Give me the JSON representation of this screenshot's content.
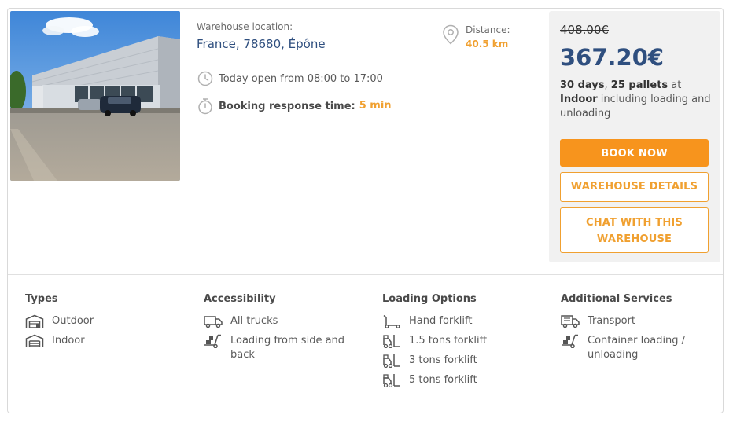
{
  "location": {
    "label": "Warehouse location:",
    "value": "France, 78680, Épône"
  },
  "hours": {
    "icon": "clock-icon",
    "text": "Today open from 08:00 to 17:00"
  },
  "response": {
    "icon": "stopwatch-icon",
    "label": "Booking response time:",
    "value": "5 min"
  },
  "distance": {
    "icon": "location-pin-icon",
    "label": "Distance:",
    "value": "40.5 km"
  },
  "pricing": {
    "old_price": "408.00€",
    "new_price": "367.20€",
    "summary_days": "30 days",
    "summary_sep": ", ",
    "summary_pallets": "25 pallets",
    "summary_at": " at ",
    "summary_storage": "Indoor",
    "summary_rest": " including loading and unloading"
  },
  "buttons": {
    "book": "BOOK NOW",
    "details": "WAREHOUSE DETAILS",
    "chat_line1": "CHAT WITH THIS",
    "chat_line2": "WAREHOUSE"
  },
  "features": {
    "types": {
      "title": "Types",
      "items": [
        {
          "label": "Outdoor",
          "icon": "outdoor-warehouse-icon"
        },
        {
          "label": "Indoor",
          "icon": "indoor-warehouse-icon"
        }
      ]
    },
    "accessibility": {
      "title": "Accessibility",
      "items": [
        {
          "label": "All trucks",
          "icon": "truck-icon"
        },
        {
          "label": "Loading from side and back",
          "icon": "hand-truck-boxes-icon"
        }
      ]
    },
    "loading": {
      "title": "Loading Options",
      "items": [
        {
          "label": "Hand forklift",
          "icon": "hand-pallet-jack-icon"
        },
        {
          "label": "1.5 tons forklift",
          "icon": "forklift-icon"
        },
        {
          "label": "3 tons forklift",
          "icon": "forklift-icon"
        },
        {
          "label": "5 tons forklift",
          "icon": "forklift-icon"
        }
      ]
    },
    "additional": {
      "title": "Additional Services",
      "items": [
        {
          "label": "Transport",
          "icon": "delivery-truck-icon"
        },
        {
          "label": "Container loading / unloading",
          "icon": "hand-truck-boxes-icon"
        }
      ]
    }
  },
  "colors": {
    "accent": "#f7941d",
    "accent_text": "#f0a030",
    "price_blue": "#2f4f7f",
    "panel_bg": "#f1f1f1"
  }
}
